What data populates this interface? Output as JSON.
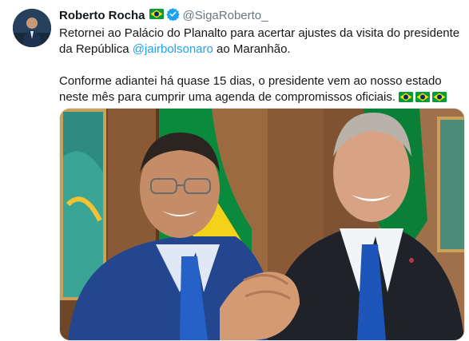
{
  "author": {
    "name": "Roberto Rocha",
    "handle": "@SigaRoberto_",
    "verified": true,
    "flag_icon": "brazil-flag-emoji"
  },
  "tweet": {
    "paragraph1_before": "Retornei ao Palácio do Planalto para acertar ajustes da visita do presidente da República ",
    "mention": "@jairbolsonaro",
    "paragraph1_after": " ao Maranhão.",
    "paragraph2": "Conforme adiantei há quase 15 dias, o presidente vem ao nosso estado neste mês para cumprir uma agenda de compromissos oficiais.",
    "trailing_flags": 3
  },
  "media": {
    "type": "photo",
    "icon": "photo-two-men-handshake"
  },
  "colors": {
    "text": "#14171a",
    "secondary": "#657786",
    "link": "#1da1f2",
    "verified": "#1da1f2",
    "flag_green": "#009c3b",
    "flag_yellow": "#ffdf00",
    "flag_blue": "#002776"
  }
}
